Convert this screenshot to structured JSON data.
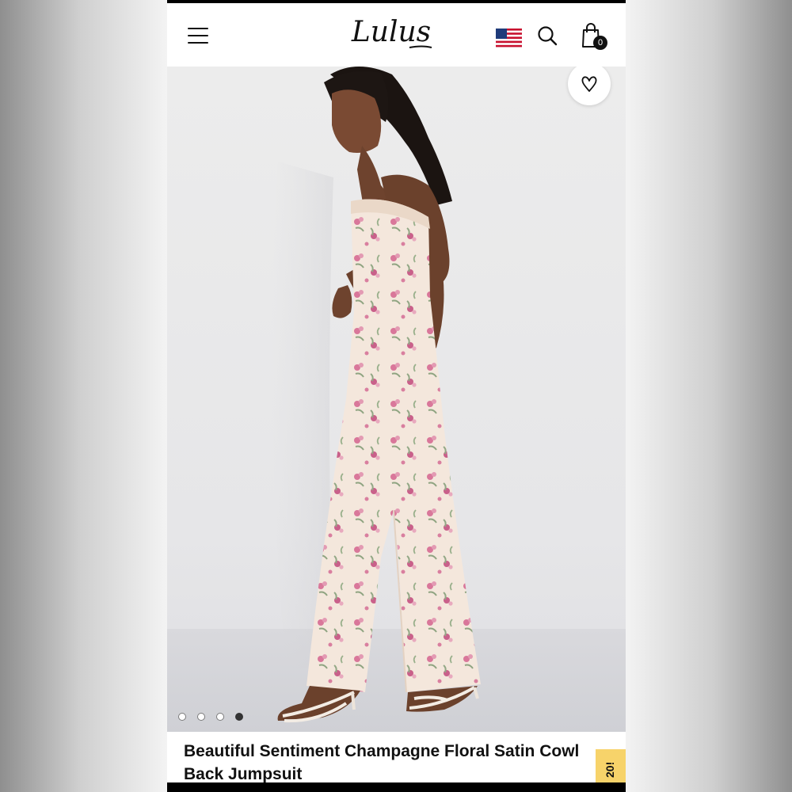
{
  "header": {
    "logo_text": "Lulus",
    "cart_count": "0",
    "icons": [
      "menu-icon",
      "us-flag-icon",
      "search-icon",
      "shopping-bag-icon"
    ]
  },
  "hero": {
    "icons": [
      "heart-icon"
    ],
    "carousel": {
      "total": 4,
      "active_index": 4
    }
  },
  "product": {
    "title": "Beautiful Sentiment Champagne Floral Satin Cowl Back Jumpsuit",
    "promo_text": "20!"
  },
  "colors": {
    "accent": "#f7d36a",
    "text": "#111111",
    "background": "#ffffff"
  }
}
